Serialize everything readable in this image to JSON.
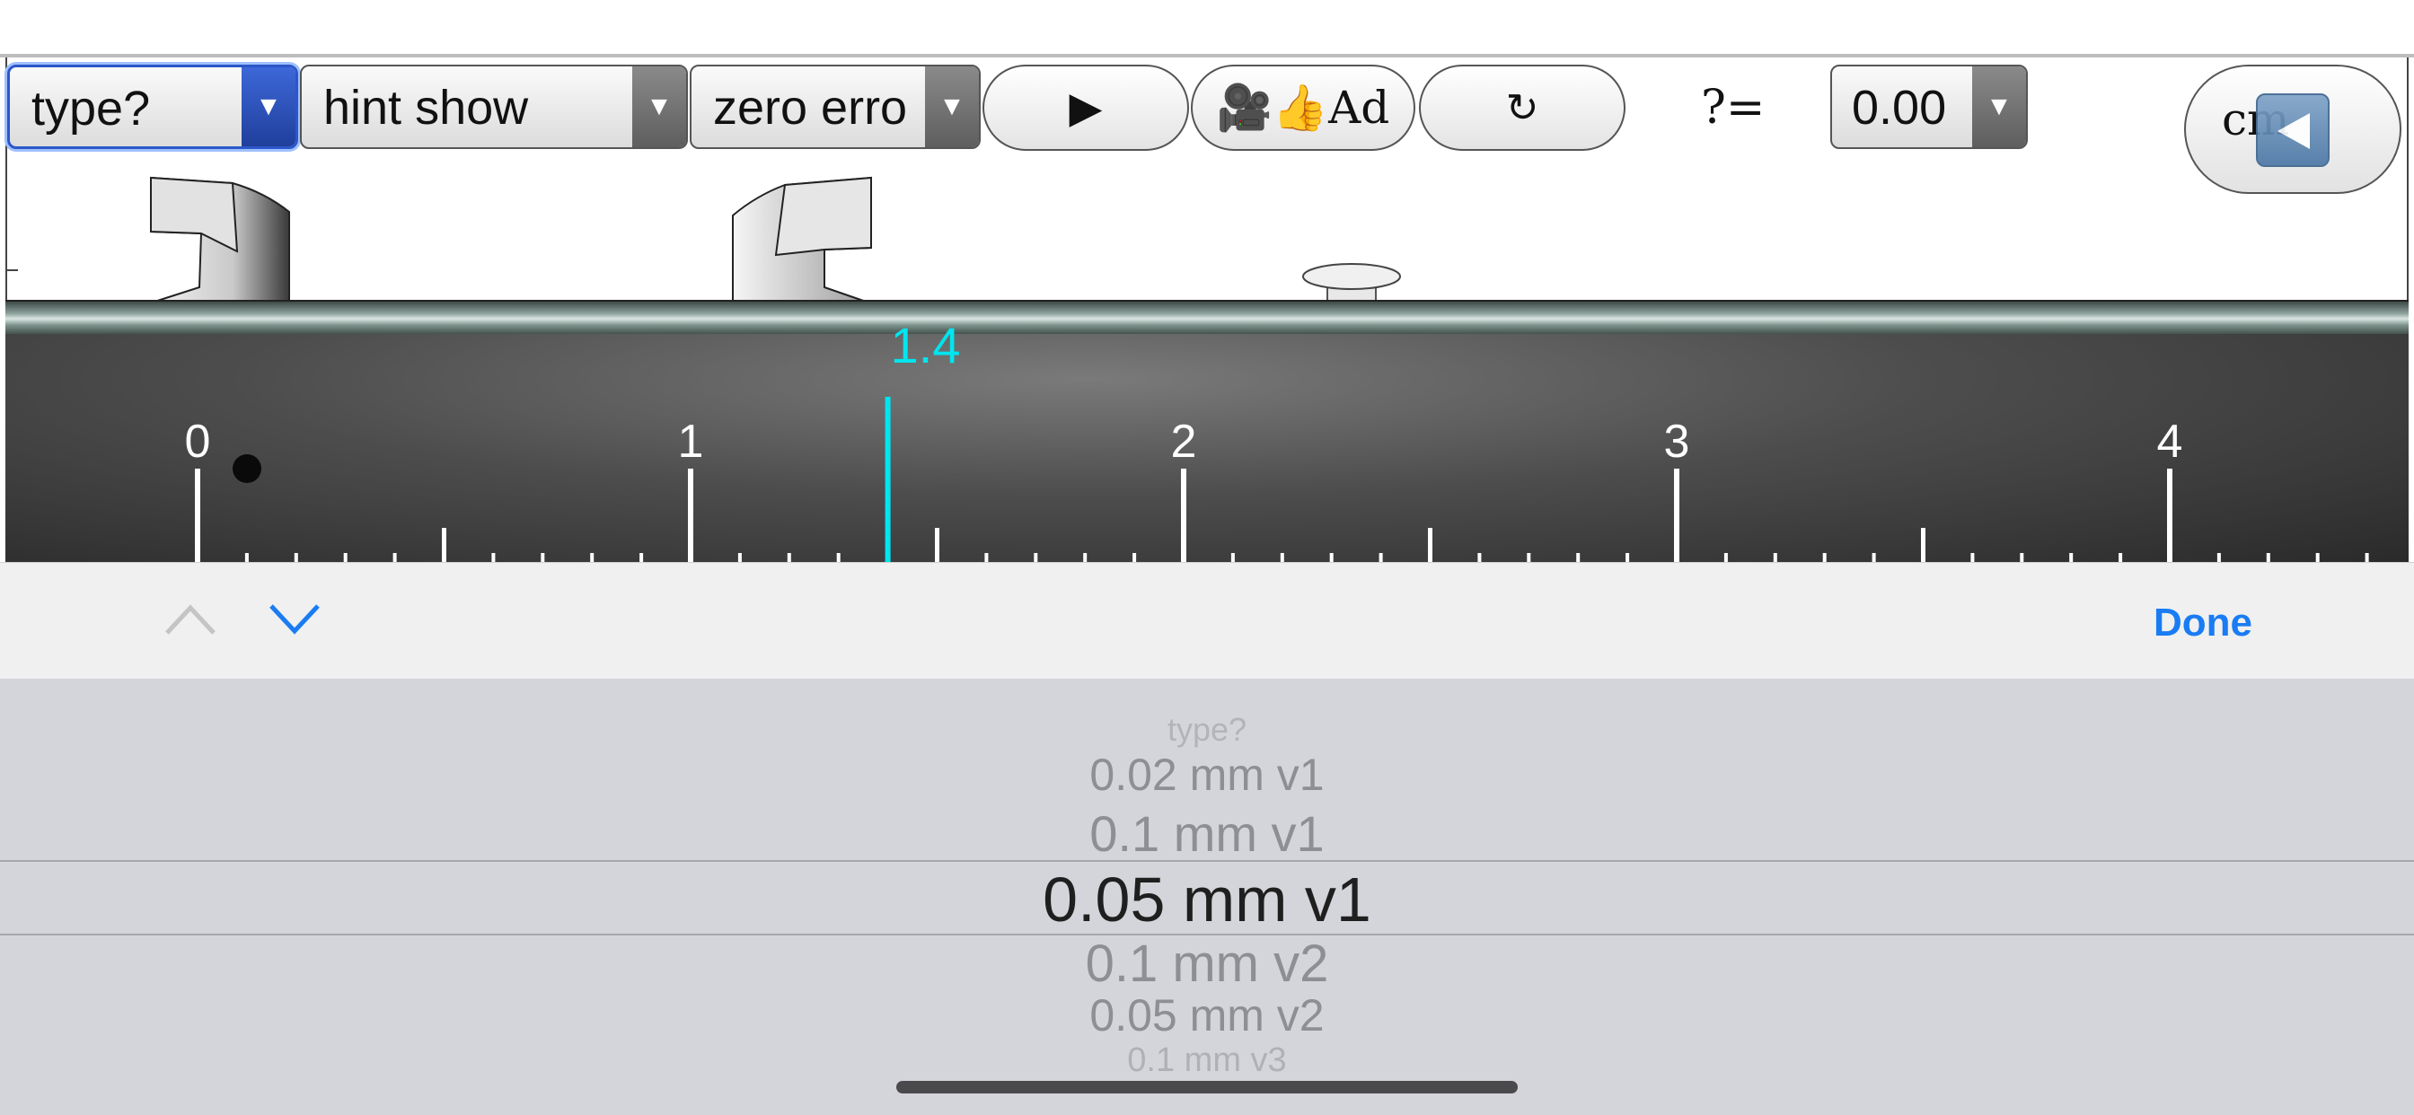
{
  "toolbar": {
    "type_select": {
      "value": "type?"
    },
    "hint_select": {
      "value": "hint show"
    },
    "zero_select": {
      "value": "zero erro"
    },
    "play_label": "▶",
    "ad_label": "🎥👍Ad",
    "reset_label": "↻",
    "question_label": "?=",
    "value_select": {
      "value": "0.00"
    },
    "unit_label": "cm",
    "dropdown_arrow": "▼"
  },
  "scale": {
    "reading": "1.4",
    "labels": [
      "0",
      "1",
      "2",
      "3",
      "4"
    ],
    "reading_color": "#00e5ee"
  },
  "accessory": {
    "done_label": "Done",
    "accent_color": "#1a7cf3"
  },
  "picker": {
    "options": [
      "type?",
      "0.02 mm v1",
      "0.1 mm v1",
      "0.05 mm v1",
      "0.1 mm v2",
      "0.05 mm v2",
      "0.1 mm v3"
    ],
    "selected_index": 3
  }
}
